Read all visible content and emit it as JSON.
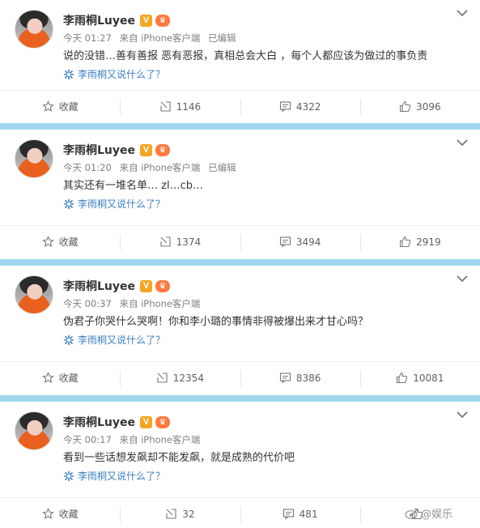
{
  "posts": [
    {
      "author": "李雨桐Luyee",
      "verified_badge": "V",
      "vip_badge": "♛",
      "time": "今天 01:27",
      "source": "来自 iPhone客户端",
      "edited": "已编辑",
      "content": "说的没错…善有善报 恶有恶报，真相总会大白 ，每个人都应该为做过的事负责",
      "mention": "李雨桐又说什么了？",
      "actions": {
        "favorite": "收藏",
        "repost": "1146",
        "comment": "4322",
        "like": "3096"
      }
    },
    {
      "author": "李雨桐Luyee",
      "verified_badge": "V",
      "vip_badge": "♛",
      "time": "今天 01:20",
      "source": "来自 iPhone客户端",
      "edited": "已编辑",
      "content": "其实还有一堆名单… zl…cb…",
      "mention": "李雨桐又说什么了？",
      "actions": {
        "favorite": "收藏",
        "repost": "1374",
        "comment": "3494",
        "like": "2919"
      }
    },
    {
      "author": "李雨桐Luyee",
      "verified_badge": "V",
      "vip_badge": "♛",
      "time": "今天 00:37",
      "source": "来自 iPhone客户端",
      "edited": "",
      "content": "伪君子你哭什么哭啊！你和李小璐的事情非得被爆出来才甘心吗？",
      "mention": "李雨桐又说什么了？",
      "actions": {
        "favorite": "收藏",
        "repost": "12354",
        "comment": "8386",
        "like": "10081"
      }
    },
    {
      "author": "李雨桐Luyee",
      "verified_badge": "V",
      "vip_badge": "♛",
      "time": "今天 00:17",
      "source": "来自 iPhone客户端",
      "edited": "",
      "content": "看到一些话想发飙却不能发飙，就是成熟的代价吧",
      "mention": "李雨桐又说什么了？",
      "actions": {
        "favorite": "收藏",
        "repost": "32",
        "comment": "481",
        "like": ""
      }
    }
  ],
  "watermark": "@娱乐",
  "colors": {
    "divider": "#9fd8ee",
    "link": "#3b7fc4",
    "badge": "#f5a623"
  },
  "icons": [
    "avatar",
    "verified-badge",
    "vip-crown-icon",
    "chevron-down-icon",
    "mention-star-icon",
    "favorite-icon",
    "repost-icon",
    "comment-icon",
    "like-icon",
    "weibo-logo-icon"
  ]
}
